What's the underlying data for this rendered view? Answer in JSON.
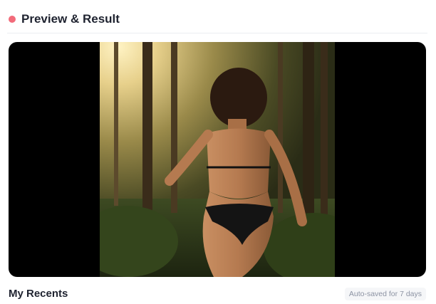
{
  "header": {
    "title": "Preview & Result",
    "accent_color": "#f26b7a"
  },
  "preview": {
    "media_icon": "photo-preview",
    "letterbox_color": "#000000"
  },
  "recents": {
    "title": "My Recents",
    "autosave_note": "Auto-saved for 7 days"
  }
}
